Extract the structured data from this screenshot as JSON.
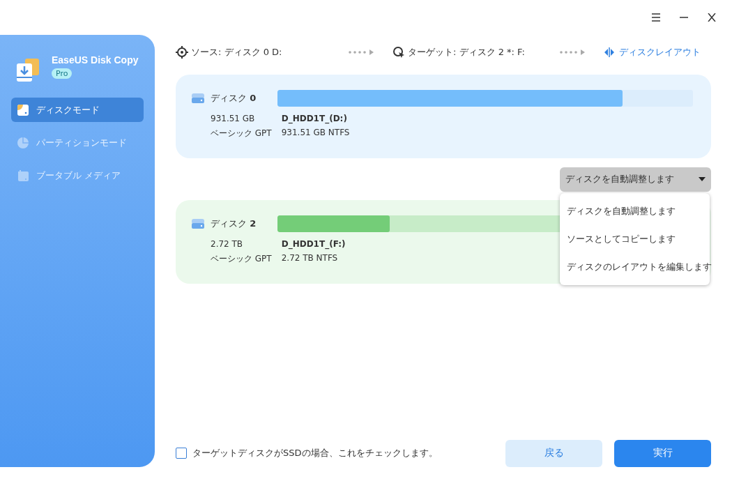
{
  "app": {
    "name": "EaseUS Disk Copy",
    "edition": "Pro"
  },
  "sidebar": {
    "items": [
      {
        "label": "ディスクモード",
        "selected": true,
        "disabled": false,
        "kind": "disk"
      },
      {
        "label": "パーティションモード",
        "selected": false,
        "disabled": true,
        "kind": "partition"
      },
      {
        "label": "ブータブル メディア",
        "selected": false,
        "disabled": true,
        "kind": "bootable"
      }
    ]
  },
  "path": {
    "source": "ソース: ディスク 0 D:",
    "target": "ターゲット: ディスク 2 *: F:",
    "layout_link": "ディスクレイアウト"
  },
  "disks": [
    {
      "name": "ディスク **0**",
      "size": "931.51 GB",
      "type": "ベーシック GPT",
      "volume": "D_HDD1T_(D:)",
      "detail": "931.51 GB NTFS",
      "level": 0.83,
      "color": "#74bdfb",
      "kind": "source"
    },
    {
      "name": "ディスク **2**",
      "size": "2.72 TB",
      "type": "ベーシック GPT",
      "volume": "D_HDD1T_(F:)",
      "detail": "2.72 TB NTFS",
      "level": 0.27,
      "color": "#74cd78",
      "kind": "target"
    }
  ],
  "layout_select": {
    "value": "ディスクを自動調整します",
    "expanded": true,
    "options": [
      "ディスクを自動調整します",
      "ソースとしてコピーします",
      "ディスクのレイアウトを編集します"
    ]
  },
  "ssd_check": {
    "label": "ターゲットディスクがSSDの場合、これをチェックします。",
    "checked": false
  },
  "buttons": [
    {
      "label": "戻る",
      "kind": "secondary"
    },
    {
      "label": "実行",
      "kind": "primary"
    }
  ]
}
